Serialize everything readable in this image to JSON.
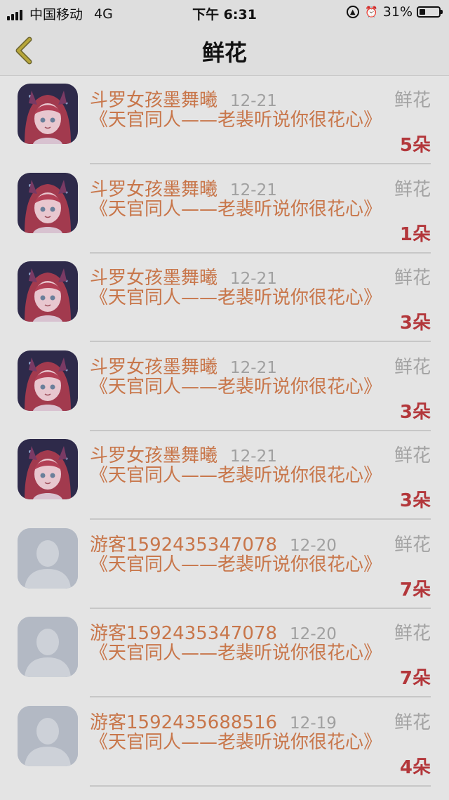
{
  "status_bar": {
    "carrier": "中国移动",
    "network": "4G",
    "time": "下午 6:31",
    "battery_percent": "31%"
  },
  "nav": {
    "title": "鲜花"
  },
  "items": [
    {
      "name": "斗罗女孩墨舞曦",
      "date": "12-21",
      "gift": "鲜花",
      "message": "《天官同人——老裴听说你很花心》",
      "count": "5朵",
      "avatar": "anime-avatar"
    },
    {
      "name": "斗罗女孩墨舞曦",
      "date": "12-21",
      "gift": "鲜花",
      "message": "《天官同人——老裴听说你很花心》",
      "count": "1朵",
      "avatar": "anime-avatar"
    },
    {
      "name": "斗罗女孩墨舞曦",
      "date": "12-21",
      "gift": "鲜花",
      "message": "《天官同人——老裴听说你很花心》",
      "count": "3朵",
      "avatar": "anime-avatar"
    },
    {
      "name": "斗罗女孩墨舞曦",
      "date": "12-21",
      "gift": "鲜花",
      "message": "《天官同人——老裴听说你很花心》",
      "count": "3朵",
      "avatar": "anime-avatar"
    },
    {
      "name": "斗罗女孩墨舞曦",
      "date": "12-21",
      "gift": "鲜花",
      "message": "《天官同人——老裴听说你很花心》",
      "count": "3朵",
      "avatar": "anime-avatar"
    },
    {
      "name": "游客1592435347078",
      "date": "12-20",
      "gift": "鲜花",
      "message": "《天官同人——老裴听说你很花心》",
      "count": "7朵",
      "avatar": "guest-avatar"
    },
    {
      "name": "游客1592435347078",
      "date": "12-20",
      "gift": "鲜花",
      "message": "《天官同人——老裴听说你很花心》",
      "count": "7朵",
      "avatar": "guest-avatar"
    },
    {
      "name": "游客1592435688516",
      "date": "12-19",
      "gift": "鲜花",
      "message": "《天官同人——老裴听说你很花心》",
      "count": "4朵",
      "avatar": "guest-avatar"
    }
  ]
}
